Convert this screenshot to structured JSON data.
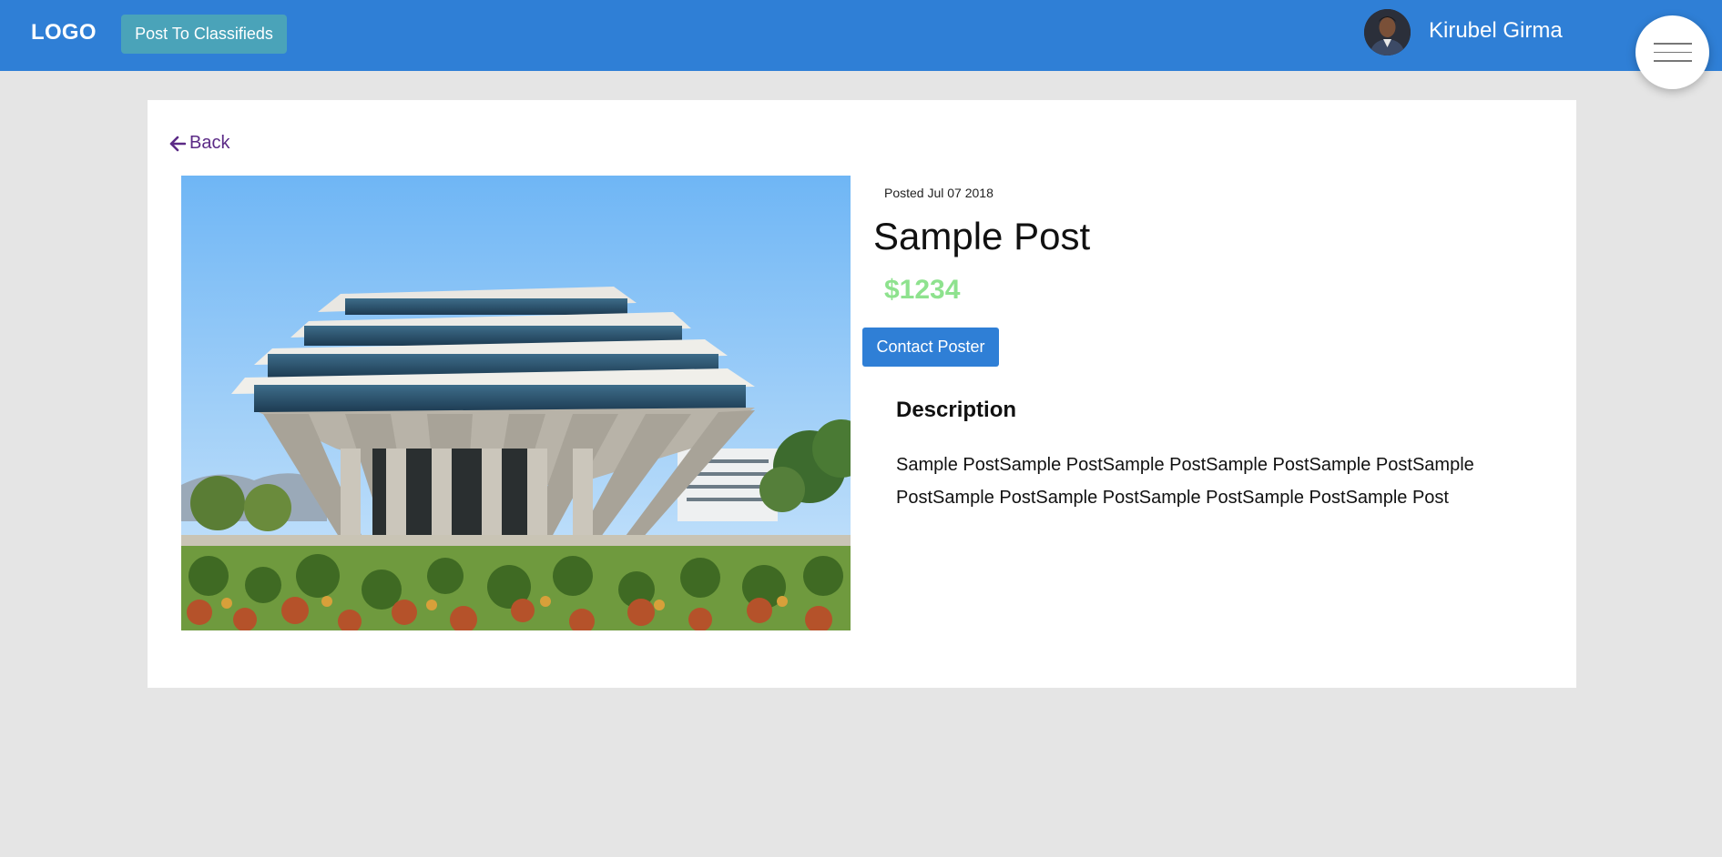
{
  "header": {
    "logo": "LOGO",
    "post_button": "Post To Classifieds",
    "user_name": "Kirubel Girma",
    "accent_color": "#2f7fd6"
  },
  "icons": {
    "back": "arrow-left-icon",
    "menu": "hamburger-menu-icon",
    "avatar": "user-avatar"
  },
  "post": {
    "back_label": "Back",
    "posted": "Posted Jul 07 2018",
    "title": "Sample Post",
    "price": "$1234",
    "contact_button": "Contact Poster",
    "description_heading": "Description",
    "description": "Sample PostSample PostSample PostSample PostSample PostSample PostSample PostSample PostSample PostSample PostSample Post",
    "price_color": "#8ee28e"
  }
}
